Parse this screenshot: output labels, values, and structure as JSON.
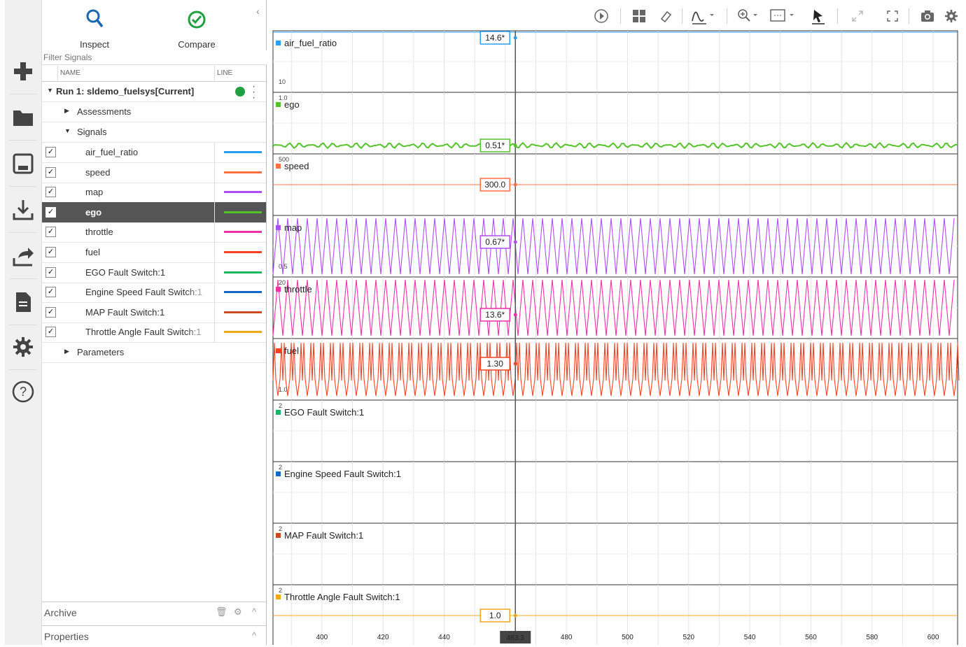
{
  "tabs": [
    {
      "label": "Inspect",
      "icon": "search-icon",
      "active": true
    },
    {
      "label": "Compare",
      "icon": "check-circle-icon",
      "active": false
    }
  ],
  "filter": {
    "placeholder": "Filter Signals"
  },
  "table_header": {
    "name": "NAME",
    "line": "LINE"
  },
  "run": {
    "label": "Run 1: sldemo_fuelsys[Current]",
    "status_color": "#20a040"
  },
  "groups": {
    "assessments": "Assessments",
    "signals": "Signals",
    "parameters": "Parameters"
  },
  "signals": [
    {
      "name": "air_fuel_ratio",
      "color": "#2a9df4",
      "checked": true,
      "selected": false
    },
    {
      "name": "speed",
      "color": "#ff7043",
      "checked": true,
      "selected": false
    },
    {
      "name": "map",
      "color": "#b04df2",
      "checked": true,
      "selected": false
    },
    {
      "name": "ego",
      "color": "#55c22a",
      "checked": true,
      "selected": true
    },
    {
      "name": "throttle",
      "color": "#ef2fa8",
      "checked": true,
      "selected": false
    },
    {
      "name": "fuel",
      "color": "#f44323",
      "checked": true,
      "selected": false
    },
    {
      "name": "EGO Fault Switch:1",
      "color": "#19b563",
      "checked": true,
      "selected": false
    },
    {
      "name": "Engine Speed Fault Switch:1",
      "color": "#1467c2",
      "checked": true,
      "selected": false
    },
    {
      "name": "MAP Fault Switch:1",
      "color": "#c94a24",
      "checked": true,
      "selected": false
    },
    {
      "name": "Throttle Angle Fault Switch:1",
      "color": "#f0a818",
      "checked": true,
      "selected": false
    }
  ],
  "footer": {
    "archive": "Archive",
    "properties": "Properties"
  },
  "rail_icons": [
    "plus-icon",
    "folder-icon",
    "save-icon",
    "download-icon",
    "share-icon",
    "document-icon",
    "settings-icon",
    "help-icon"
  ],
  "toolbar_icons": [
    "play-icon",
    "layout-grid-icon",
    "eraser-icon",
    "signal-style-icon",
    "zoom-icon",
    "fit-view-icon",
    "cursor-icon",
    "expand-icon",
    "fullscreen-icon",
    "snapshot-icon",
    "settings-icon"
  ],
  "plots": [
    {
      "name": "air_fuel_ratio",
      "color": "#2a9df4",
      "cursor_value": "14.6*",
      "ytop": "",
      "ybot": "10",
      "wave": "flat-top"
    },
    {
      "name": "ego",
      "color": "#55c22a",
      "cursor_value": "0.51*",
      "ytop": "1.0",
      "ybot": "",
      "wave": "noise"
    },
    {
      "name": "speed",
      "color": "#ff7043",
      "cursor_value": "300.0",
      "ytop": "500",
      "ybot": "",
      "wave": "flat-mid"
    },
    {
      "name": "map",
      "color": "#b04df2",
      "cursor_value": "0.67*",
      "ytop": "",
      "ybot": "0.5",
      "wave": "triangle"
    },
    {
      "name": "throttle",
      "color": "#ef2fa8",
      "cursor_value": "13.6*",
      "ytop": "20",
      "ybot": "",
      "wave": "triangle"
    },
    {
      "name": "fuel",
      "color": "#f44323",
      "cursor_value": "1.30",
      "ytop": "",
      "ybot": "1.0",
      "wave": "spiky"
    },
    {
      "name": "EGO Fault Switch:1",
      "color": "#19b563",
      "cursor_value": "",
      "ytop": "2",
      "ybot": "",
      "wave": "none"
    },
    {
      "name": "Engine Speed Fault Switch:1",
      "color": "#1467c2",
      "cursor_value": "",
      "ytop": "2",
      "ybot": "",
      "wave": "none"
    },
    {
      "name": "MAP Fault Switch:1",
      "color": "#c94a24",
      "cursor_value": "",
      "ytop": "2",
      "ybot": "",
      "wave": "none"
    },
    {
      "name": "Throttle Angle Fault Switch:1",
      "color": "#f0a818",
      "cursor_value": "1.0",
      "ytop": "2",
      "ybot": "",
      "wave": "flat-mid"
    }
  ],
  "x_axis": {
    "ticks": [
      "400",
      "420",
      "440",
      "480",
      "500",
      "520",
      "540",
      "560",
      "580",
      "600"
    ],
    "range": [
      384,
      608
    ],
    "tick_values": [
      400,
      420,
      440,
      480,
      500,
      520,
      540,
      560,
      580,
      600
    ]
  },
  "cursor": {
    "time": "463.3",
    "time_value": 463.3
  }
}
